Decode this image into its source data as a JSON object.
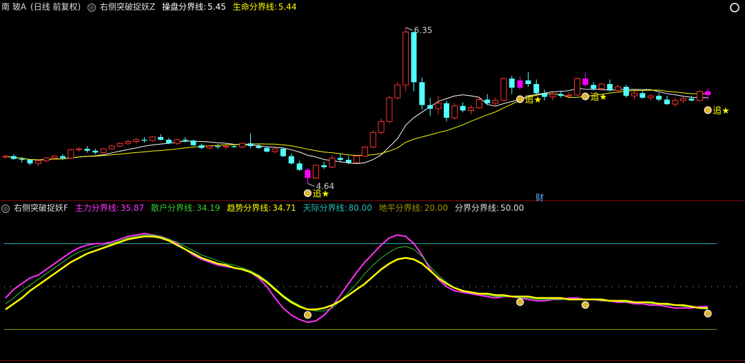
{
  "top_panel": {
    "stock": "南 玻A",
    "mode": "(日线 前复权)",
    "indicator": "右侧突破捉妖Z",
    "l1_label": "操盘分界线:",
    "l1_value": "5.45",
    "l1_color": "#ffffff",
    "l2_label": "生命分界线:",
    "l2_value": "5.44",
    "l2_color": "#ffff00"
  },
  "bottom_panel": {
    "indicator": "右侧突破捉妖F",
    "s1_label": "主力分界线:",
    "s1_value": "35.87",
    "s1_color": "#ff33ff",
    "s2_label": "散户分界线:",
    "s2_value": "34.19",
    "s2_color": "#33cc33",
    "s3_label": "趋势分界线:",
    "s3_value": "34.71",
    "s3_color": "#ffff00",
    "s4_label": "天际分界线:",
    "s4_value": "80.00",
    "s4_color": "#22bbbb",
    "s5_label": "地平分界线:",
    "s5_value": "20.00",
    "s5_color": "#999900",
    "s6_label": "分界分界线:",
    "s6_value": "50.00",
    "s6_color": "#dddddd"
  },
  "marker_label": "财",
  "signal_text": "追",
  "chart_data": [
    {
      "type": "candlestick",
      "high_label": "6.35",
      "low_label": "4.64",
      "ylim": [
        4.5,
        6.5
      ],
      "up_color": "#ff3333",
      "down_color": "#54ffff",
      "signal_color": "#ff00ff",
      "candles": [
        [
          4.93,
          4.95,
          4.91,
          4.94
        ],
        [
          4.94,
          4.96,
          4.9,
          4.91
        ],
        [
          4.91,
          4.93,
          4.87,
          4.9
        ],
        [
          4.9,
          4.91,
          4.84,
          4.86
        ],
        [
          4.86,
          4.9,
          4.83,
          4.89
        ],
        [
          4.89,
          4.93,
          4.87,
          4.92
        ],
        [
          4.92,
          4.95,
          4.9,
          4.94
        ],
        [
          4.94,
          4.96,
          4.9,
          4.92
        ],
        [
          4.92,
          5.02,
          4.91,
          5.01
        ],
        [
          5.01,
          5.04,
          4.99,
          5.02
        ],
        [
          5.02,
          5.05,
          4.98,
          5.0
        ],
        [
          5.0,
          5.02,
          4.96,
          4.98
        ],
        [
          4.98,
          5.03,
          4.97,
          5.02
        ],
        [
          5.02,
          5.06,
          5.01,
          5.05
        ],
        [
          5.05,
          5.09,
          5.04,
          5.08
        ],
        [
          5.08,
          5.12,
          5.06,
          5.1
        ],
        [
          5.1,
          5.14,
          5.08,
          5.12
        ],
        [
          5.12,
          5.15,
          5.09,
          5.11
        ],
        [
          5.11,
          5.16,
          5.1,
          5.15
        ],
        [
          5.15,
          5.18,
          5.11,
          5.12
        ],
        [
          5.12,
          5.14,
          5.07,
          5.08
        ],
        [
          5.08,
          5.13,
          5.06,
          5.12
        ],
        [
          5.12,
          5.15,
          5.09,
          5.11
        ],
        [
          5.11,
          5.12,
          5.05,
          5.06
        ],
        [
          5.06,
          5.08,
          5.02,
          5.03
        ],
        [
          5.03,
          5.06,
          5.01,
          5.05
        ],
        [
          5.05,
          5.07,
          5.02,
          5.04
        ],
        [
          5.04,
          5.06,
          5.02,
          5.05
        ],
        [
          5.05,
          5.06,
          5.03,
          5.04
        ],
        [
          5.04,
          5.09,
          5.03,
          5.08
        ],
        [
          5.08,
          5.19,
          5.03,
          5.05
        ],
        [
          5.05,
          5.07,
          5.02,
          5.03
        ],
        [
          5.03,
          5.05,
          4.98,
          4.99
        ],
        [
          4.99,
          5.03,
          4.97,
          5.02
        ],
        [
          5.02,
          5.03,
          4.93,
          4.94
        ],
        [
          4.94,
          4.97,
          4.85,
          4.86
        ],
        [
          4.86,
          4.89,
          4.78,
          4.79
        ],
        [
          4.79,
          4.81,
          4.64,
          4.7
        ],
        [
          4.7,
          4.85,
          4.69,
          4.84
        ],
        [
          4.84,
          4.88,
          4.8,
          4.82
        ],
        [
          4.82,
          4.95,
          4.81,
          4.92
        ],
        [
          4.92,
          4.97,
          4.88,
          4.9
        ],
        [
          4.9,
          4.94,
          4.85,
          4.87
        ],
        [
          4.87,
          4.95,
          4.86,
          4.94
        ],
        [
          4.94,
          5.05,
          4.93,
          5.04
        ],
        [
          5.04,
          5.22,
          5.03,
          5.2
        ],
        [
          5.2,
          5.35,
          5.18,
          5.32
        ],
        [
          5.32,
          5.6,
          5.3,
          5.58
        ],
        [
          5.58,
          5.75,
          5.56,
          5.72
        ],
        [
          5.72,
          6.35,
          5.65,
          6.3
        ],
        [
          6.3,
          5.8,
          5.65,
          5.75
        ],
        [
          5.75,
          5.8,
          5.45,
          5.5
        ],
        [
          5.5,
          5.58,
          5.38,
          5.46
        ],
        [
          5.46,
          5.6,
          5.4,
          5.52
        ],
        [
          5.52,
          5.55,
          5.32,
          5.36
        ],
        [
          5.36,
          5.52,
          5.34,
          5.49
        ],
        [
          5.49,
          5.53,
          5.42,
          5.44
        ],
        [
          5.44,
          5.5,
          5.4,
          5.47
        ],
        [
          5.47,
          5.58,
          5.46,
          5.56
        ],
        [
          5.56,
          5.62,
          5.5,
          5.52
        ],
        [
          5.52,
          5.58,
          5.48,
          5.55
        ],
        [
          5.55,
          5.8,
          5.54,
          5.79
        ],
        [
          5.79,
          5.82,
          5.62,
          5.69
        ],
        [
          5.69,
          5.81,
          5.67,
          5.77
        ],
        [
          5.77,
          5.86,
          5.7,
          5.73
        ],
        [
          5.73,
          5.78,
          5.61,
          5.63
        ],
        [
          5.63,
          5.67,
          5.55,
          5.59
        ],
        [
          5.59,
          5.64,
          5.55,
          5.62
        ],
        [
          5.62,
          5.66,
          5.58,
          5.6
        ],
        [
          5.6,
          5.64,
          5.57,
          5.61
        ],
        [
          5.61,
          5.8,
          5.6,
          5.79
        ],
        [
          5.79,
          5.86,
          5.7,
          5.72
        ],
        [
          5.72,
          5.75,
          5.66,
          5.68
        ],
        [
          5.68,
          5.74,
          5.66,
          5.73
        ],
        [
          5.73,
          5.78,
          5.65,
          5.66
        ],
        [
          5.66,
          5.72,
          5.64,
          5.7
        ],
        [
          5.7,
          5.72,
          5.58,
          5.6
        ],
        [
          5.6,
          5.66,
          5.56,
          5.63
        ],
        [
          5.63,
          5.66,
          5.57,
          5.58
        ],
        [
          5.58,
          5.62,
          5.55,
          5.6
        ],
        [
          5.6,
          5.63,
          5.54,
          5.56
        ],
        [
          5.56,
          5.6,
          5.5,
          5.51
        ],
        [
          5.51,
          5.58,
          5.48,
          5.55
        ],
        [
          5.55,
          5.59,
          5.52,
          5.57
        ],
        [
          5.57,
          5.6,
          5.54,
          5.55
        ],
        [
          5.55,
          5.66,
          5.54,
          5.65
        ],
        [
          5.65,
          5.68,
          5.55,
          5.61
        ]
      ],
      "signal_days": [
        37,
        63,
        71,
        86
      ]
    },
    {
      "type": "line",
      "ylim": [
        0,
        100
      ],
      "series": [
        {
          "name": "主力分界线",
          "color": "#ff33ff",
          "values": [
            42,
            48,
            52,
            56,
            58,
            62,
            66,
            70,
            74,
            77,
            79,
            80,
            80,
            81,
            83,
            85,
            86,
            87,
            86,
            85,
            83,
            80,
            76,
            72,
            69,
            67,
            65,
            64,
            63,
            62,
            60,
            56,
            50,
            42,
            35,
            30,
            27,
            25,
            26,
            30,
            36,
            44,
            52,
            60,
            67,
            73,
            79,
            84,
            86,
            85,
            80,
            72,
            62,
            55,
            50,
            47,
            46,
            45,
            44,
            43,
            42,
            43,
            43,
            42,
            41,
            40,
            40,
            41,
            41,
            42,
            42,
            41,
            41,
            40,
            40,
            39,
            39,
            38,
            38,
            37,
            37,
            36,
            35,
            35,
            35,
            36,
            36
          ]
        },
        {
          "name": "散户分界线",
          "color": "#33cc33",
          "values": [
            38,
            42,
            47,
            51,
            55,
            59,
            63,
            67,
            71,
            74,
            76,
            78,
            79,
            80,
            82,
            84,
            85,
            86,
            86,
            85,
            83,
            81,
            78,
            75,
            72,
            70,
            68,
            66,
            65,
            63,
            61,
            58,
            54,
            49,
            44,
            40,
            37,
            34,
            33,
            33,
            35,
            40,
            46,
            52,
            59,
            65,
            70,
            74,
            77,
            78,
            76,
            71,
            64,
            58,
            53,
            49,
            47,
            46,
            45,
            44,
            43,
            43,
            43,
            42,
            42,
            41,
            41,
            41,
            41,
            41,
            41,
            41,
            41,
            40,
            40,
            40,
            39,
            39,
            39,
            38,
            38,
            37,
            37,
            36,
            36,
            35,
            34
          ]
        },
        {
          "name": "趋势分界线",
          "color": "#ffff00",
          "values": [
            34,
            38,
            42,
            47,
            51,
            55,
            59,
            63,
            67,
            70,
            73,
            75,
            77,
            79,
            81,
            83,
            84,
            85,
            85,
            84,
            82,
            79,
            76,
            73,
            70,
            68,
            66,
            65,
            63,
            62,
            60,
            57,
            53,
            48,
            43,
            39,
            36,
            34,
            34,
            35,
            37,
            40,
            44,
            48,
            52,
            57,
            62,
            66,
            69,
            70,
            69,
            66,
            61,
            56,
            52,
            49,
            47,
            46,
            45,
            45,
            44,
            44,
            43,
            43,
            43,
            42,
            42,
            42,
            42,
            41,
            41,
            41,
            41,
            41,
            40,
            40,
            40,
            39,
            39,
            39,
            38,
            38,
            37,
            37,
            36,
            35,
            35
          ]
        }
      ],
      "horizontal_lines": [
        80,
        50,
        20
      ],
      "signal_days": [
        37,
        63,
        71,
        86
      ]
    }
  ]
}
